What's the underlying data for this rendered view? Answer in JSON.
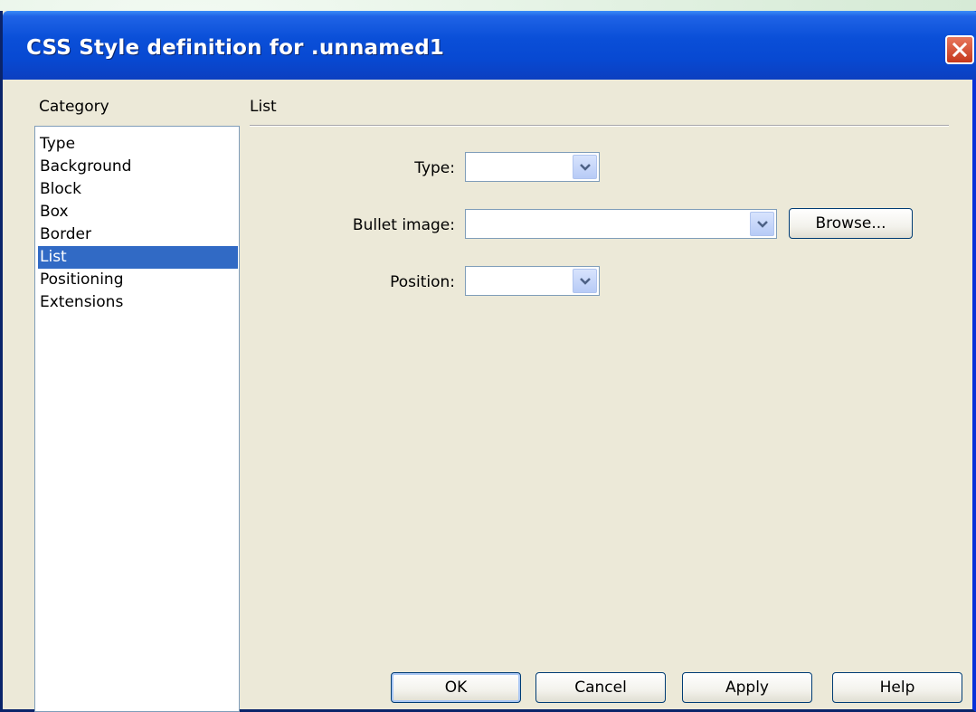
{
  "window": {
    "title": "CSS Style definition for .unnamed1",
    "close_icon": "close-icon"
  },
  "category": {
    "label": "Category",
    "items": [
      {
        "label": "Type",
        "selected": false
      },
      {
        "label": "Background",
        "selected": false
      },
      {
        "label": "Block",
        "selected": false
      },
      {
        "label": "Box",
        "selected": false
      },
      {
        "label": "Border",
        "selected": false
      },
      {
        "label": "List",
        "selected": true
      },
      {
        "label": "Positioning",
        "selected": false
      },
      {
        "label": "Extensions",
        "selected": false
      }
    ]
  },
  "panel": {
    "title": "List",
    "fields": {
      "type": {
        "label": "Type:",
        "value": ""
      },
      "bullet_image": {
        "label": "Bullet image:",
        "value": ""
      },
      "position": {
        "label": "Position:",
        "value": ""
      }
    },
    "browse_label": "Browse..."
  },
  "buttons": {
    "ok": "OK",
    "cancel": "Cancel",
    "apply": "Apply",
    "help": "Help"
  },
  "colors": {
    "titlebar": "#0a4fd8",
    "selection": "#316ac5",
    "dialog_face": "#ece9d8",
    "close_button": "#c5381c"
  }
}
